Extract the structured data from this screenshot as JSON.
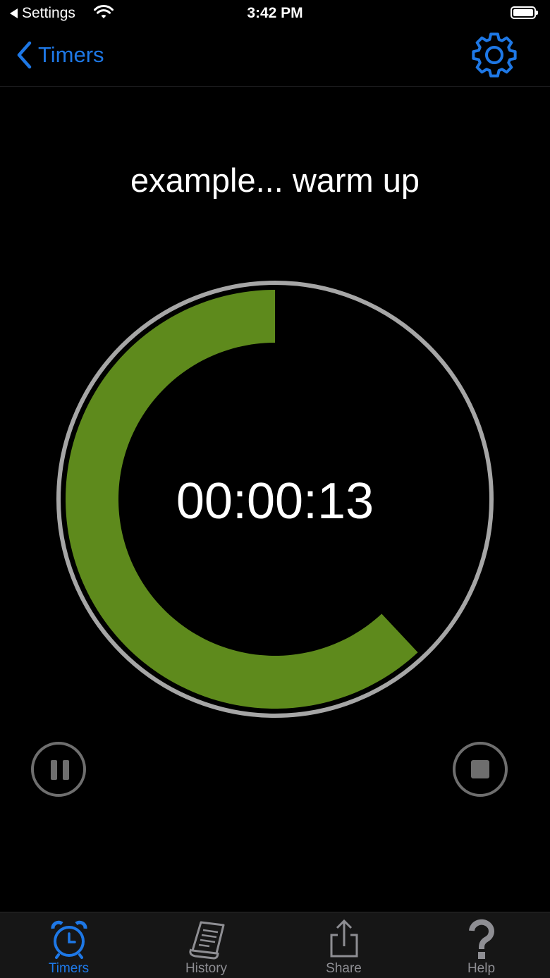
{
  "status_bar": {
    "back_label": "Settings",
    "time": "3:42 PM"
  },
  "nav": {
    "back_label": "Timers",
    "settings_icon": "gear-icon"
  },
  "timer": {
    "name": "example... warm up",
    "time": "00:00:13",
    "progress_fraction": 0.62,
    "progress_color": "#5e8a1c",
    "ring_color": "#a6a6a6"
  },
  "controls": {
    "pause_icon": "pause-icon",
    "stop_icon": "stop-icon",
    "control_color": "#6e6e6e"
  },
  "tabs": [
    {
      "label": "Timers",
      "icon": "alarm-clock-icon",
      "active": true
    },
    {
      "label": "History",
      "icon": "history-list-icon",
      "active": false
    },
    {
      "label": "Share",
      "icon": "share-icon",
      "active": false
    },
    {
      "label": "Help",
      "icon": "question-mark-icon",
      "active": false
    }
  ],
  "colors": {
    "accent": "#1e78e6",
    "background": "#000000",
    "tab_bar": "#161616",
    "inactive": "#8e8e93"
  }
}
